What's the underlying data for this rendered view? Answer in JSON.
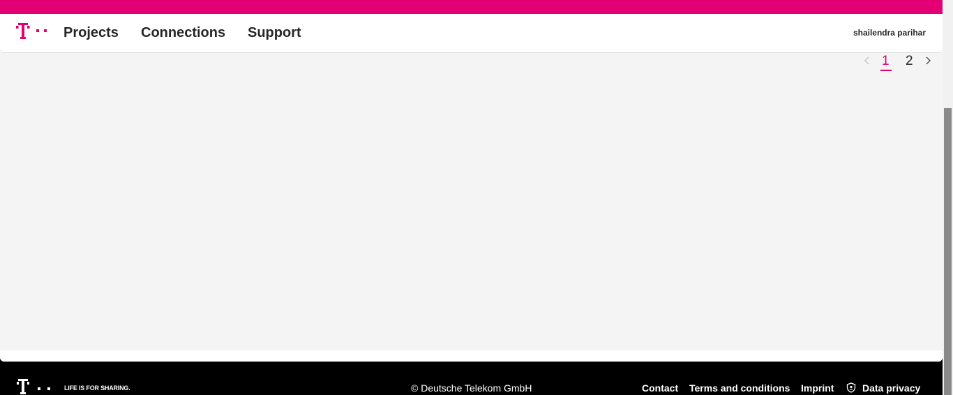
{
  "brand": {
    "color": "#e20074",
    "logo_icon": "telekom-t-logo"
  },
  "nav": {
    "items": [
      {
        "label": "Projects"
      },
      {
        "label": "Connections"
      },
      {
        "label": "Support"
      }
    ]
  },
  "user": {
    "name": "shailendra parihar"
  },
  "pagination": {
    "pages": [
      "1",
      "2"
    ],
    "current_page": "1",
    "prev_icon": "chevron-left-icon",
    "next_icon": "chevron-right-icon"
  },
  "footer": {
    "tagline": "LIFE IS FOR SHARING.",
    "copyright": "© Deutsche Telekom GmbH",
    "links": [
      {
        "label": "Contact"
      },
      {
        "label": "Terms and conditions"
      },
      {
        "label": "Imprint"
      },
      {
        "label": "Data privacy",
        "icon": "shield-icon"
      }
    ]
  }
}
